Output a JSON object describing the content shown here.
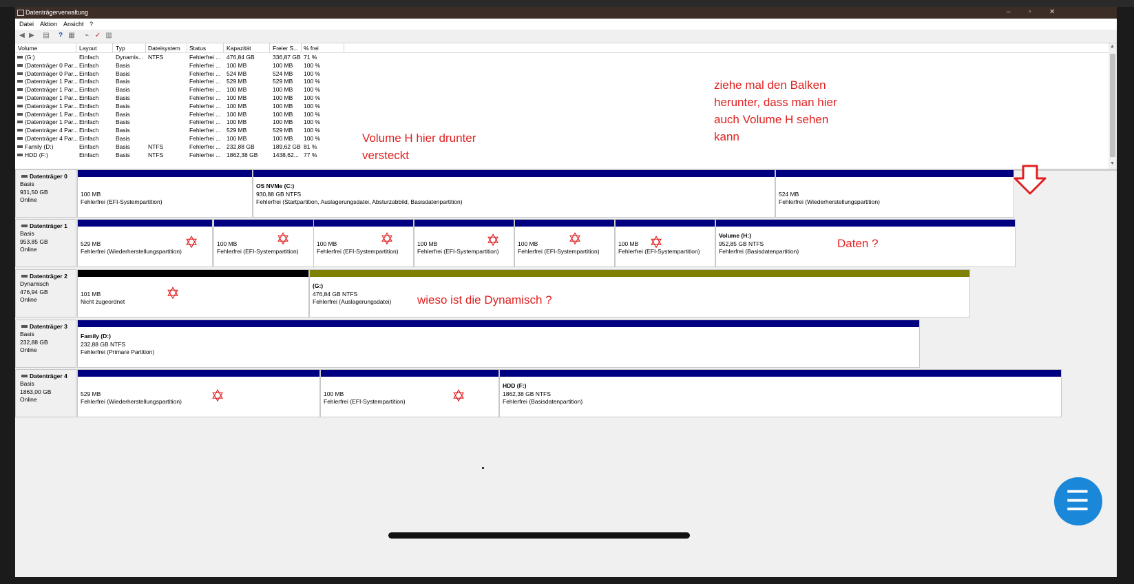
{
  "window": {
    "title": "Datenträgerverwaltung",
    "controls": [
      "–",
      "▫",
      "✕"
    ]
  },
  "menu": [
    "Datei",
    "Aktion",
    "Ansicht",
    "?"
  ],
  "toolbar": {
    "icons": [
      "back-icon",
      "forward-icon",
      "disk-list-icon",
      "help-icon",
      "properties-icon",
      "connect-icon",
      "check-icon",
      "settings-icon"
    ],
    "glyphs": [
      "◀",
      "▶",
      "▤",
      "?",
      "▦",
      "⌁",
      "✓",
      "▥"
    ]
  },
  "volume_list": {
    "columns": [
      "Volume",
      "Layout",
      "Typ",
      "Dateisystem",
      "Status",
      "Kapazität",
      "Freier S...",
      "% frei"
    ],
    "rows": [
      [
        "(G:)",
        "Einfach",
        "Dynamis...",
        "NTFS",
        "Fehlerfrei ...",
        "476,84 GB",
        "336,87 GB",
        "71 %"
      ],
      [
        "(Datenträger 0 Par...",
        "Einfach",
        "Basis",
        "",
        "Fehlerfrei ...",
        "100 MB",
        "100 MB",
        "100 %"
      ],
      [
        "(Datenträger 0 Par...",
        "Einfach",
        "Basis",
        "",
        "Fehlerfrei ...",
        "524 MB",
        "524 MB",
        "100 %"
      ],
      [
        "(Datenträger 1 Par...",
        "Einfach",
        "Basis",
        "",
        "Fehlerfrei ...",
        "529 MB",
        "529 MB",
        "100 %"
      ],
      [
        "(Datenträger 1 Par...",
        "Einfach",
        "Basis",
        "",
        "Fehlerfrei ...",
        "100 MB",
        "100 MB",
        "100 %"
      ],
      [
        "(Datenträger 1 Par...",
        "Einfach",
        "Basis",
        "",
        "Fehlerfrei ...",
        "100 MB",
        "100 MB",
        "100 %"
      ],
      [
        "(Datenträger 1 Par...",
        "Einfach",
        "Basis",
        "",
        "Fehlerfrei ...",
        "100 MB",
        "100 MB",
        "100 %"
      ],
      [
        "(Datenträger 1 Par...",
        "Einfach",
        "Basis",
        "",
        "Fehlerfrei ...",
        "100 MB",
        "100 MB",
        "100 %"
      ],
      [
        "(Datenträger 1 Par...",
        "Einfach",
        "Basis",
        "",
        "Fehlerfrei ...",
        "100 MB",
        "100 MB",
        "100 %"
      ],
      [
        "(Datenträger 4 Par...",
        "Einfach",
        "Basis",
        "",
        "Fehlerfrei ...",
        "529 MB",
        "529 MB",
        "100 %"
      ],
      [
        "(Datenträger 4 Par...",
        "Einfach",
        "Basis",
        "",
        "Fehlerfrei ...",
        "100 MB",
        "100 MB",
        "100 %"
      ],
      [
        "Family (D:)",
        "Einfach",
        "Basis",
        "NTFS",
        "Fehlerfrei ...",
        "232,88 GB",
        "189,62 GB",
        "81 %"
      ],
      [
        "HDD (F:)",
        "Einfach",
        "Basis",
        "NTFS",
        "Fehlerfrei ...",
        "1862,38 GB",
        "1438,62...",
        "77 %"
      ]
    ]
  },
  "annotations": {
    "note1": [
      "ziehe mal den Balken",
      "herunter, dass man hier",
      "auch Volume H sehen",
      "kann"
    ],
    "note2": [
      "Volume H hier drunter",
      "versteckt"
    ],
    "note3": "Daten ?",
    "note4": "wieso ist die Dynamisch ?"
  },
  "colors": {
    "primary_bar": "#000080",
    "unallocated_bar": "#000000",
    "dynamic_bar": "#808000",
    "annotation": "#e02020",
    "titlebar": "#3d2d27"
  },
  "disks": [
    {
      "name": "Datenträger 0",
      "type": "Basis",
      "size": "931,50 GB",
      "status": "Online",
      "partitions": [
        {
          "name": "",
          "size": "100 MB",
          "status": "Fehlerfrei (EFI-Systempartition)",
          "bar": "#000080"
        },
        {
          "name": "OS NVMe  (C:)",
          "size": "930,88 GB NTFS",
          "status": "Fehlerfrei (Startpartition, Auslagerungsdatei, Absturzabbild, Basisdatenpartition)",
          "bar": "#000080"
        },
        {
          "name": "",
          "size": "524 MB",
          "status": "Fehlerfrei (Wiederherstellungspartition)",
          "bar": "#000080"
        }
      ]
    },
    {
      "name": "Datenträger 1",
      "type": "Basis",
      "size": "953,85 GB",
      "status": "Online",
      "partitions": [
        {
          "name": "",
          "size": "529 MB",
          "status": "Fehlerfrei (Wiederherstellungspartition)",
          "bar": "#000080"
        },
        {
          "name": "",
          "size": "100 MB",
          "status": "Fehlerfrei (EFI-Systempartition)",
          "bar": "#000080"
        },
        {
          "name": "",
          "size": "100 MB",
          "status": "Fehlerfrei (EFI-Systempartition)",
          "bar": "#000080"
        },
        {
          "name": "",
          "size": "100 MB",
          "status": "Fehlerfrei (EFI-Systempartition)",
          "bar": "#000080"
        },
        {
          "name": "",
          "size": "100 MB",
          "status": "Fehlerfrei (EFI-Systempartition)",
          "bar": "#000080"
        },
        {
          "name": "",
          "size": "100 MB",
          "status": "Fehlerfrei (EFI-Systempartition)",
          "bar": "#000080"
        },
        {
          "name": "Volume  (H:)",
          "size": "952,85 GB NTFS",
          "status": "Fehlerfrei (Basisdatenpartition)",
          "bar": "#000080"
        }
      ]
    },
    {
      "name": "Datenträger 2",
      "type": "Dynamisch",
      "size": "476,94 GB",
      "status": "Online",
      "partitions": [
        {
          "name": "",
          "size": "101 MB",
          "status": "Nicht zugeordnet",
          "bar": "#000000"
        },
        {
          "name": "(G:)",
          "size": "476,84 GB NTFS",
          "status": "Fehlerfrei (Auslagerungsdatei)",
          "bar": "#808000"
        }
      ]
    },
    {
      "name": "Datenträger 3",
      "type": "Basis",
      "size": "232,88 GB",
      "status": "Online",
      "partitions": [
        {
          "name": "Family  (D:)",
          "size": "232,88 GB NTFS",
          "status": "Fehlerfrei (Primare Partition)",
          "bar": "#000080"
        }
      ]
    },
    {
      "name": "Datenträger 4",
      "type": "Basis",
      "size": "1863,00 GB",
      "status": "Online",
      "partitions": [
        {
          "name": "",
          "size": "529 MB",
          "status": "Fehlerfrei (Wiederherstellungspartition)",
          "bar": "#000080"
        },
        {
          "name": "",
          "size": "100 MB",
          "status": "Fehlerfrei (EFI-Systempartition)",
          "bar": "#000080"
        },
        {
          "name": "HDD  (F:)",
          "size": "1862,38 GB NTFS",
          "status": "Fehlerfrei (Basisdatenpartition)",
          "bar": "#000080"
        }
      ]
    }
  ],
  "fab_icon": "menu-icon",
  "fab_glyph": "☰"
}
